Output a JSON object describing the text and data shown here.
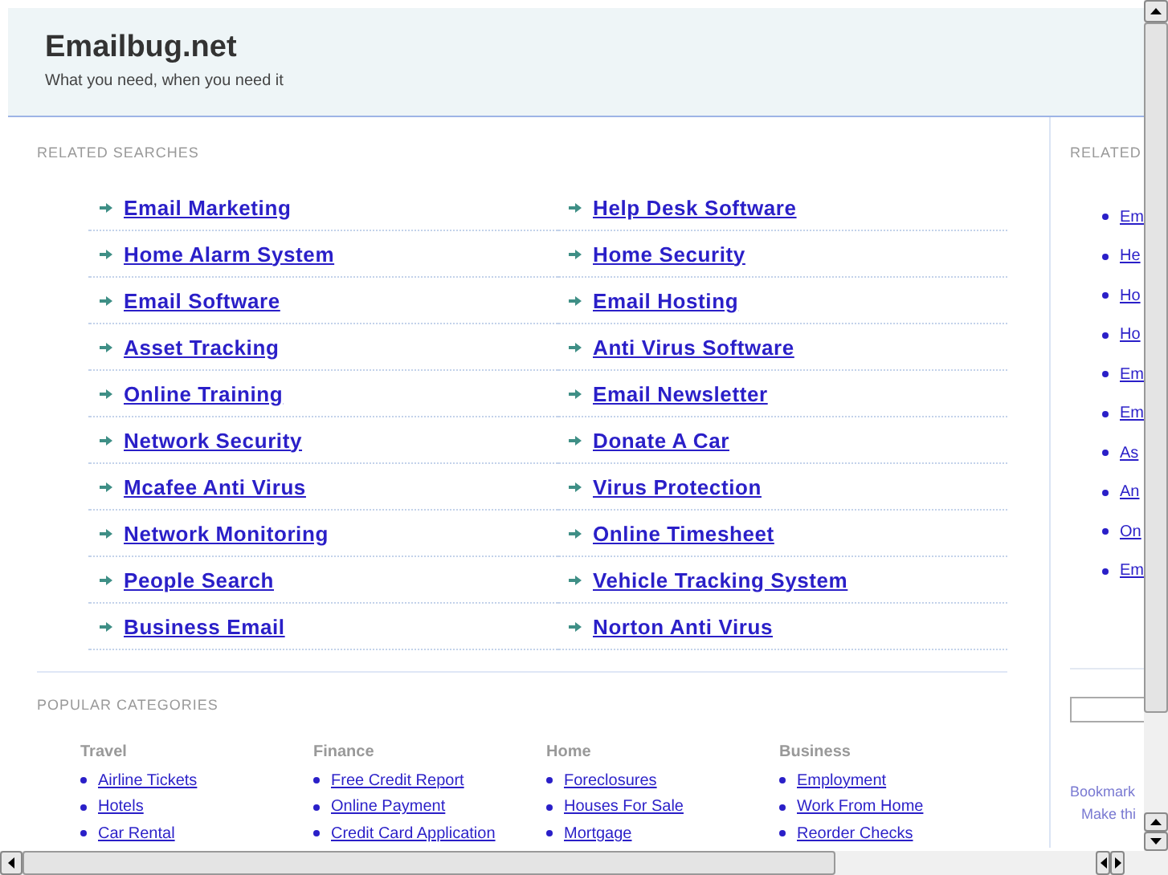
{
  "header": {
    "title": "Emailbug.net",
    "tagline": "What you need, when you need it"
  },
  "related_searches": {
    "heading": "RELATED SEARCHES",
    "links": [
      "Email Marketing",
      "Home Alarm System",
      "Email Software",
      "Asset Tracking",
      "Online Training",
      "Network Security",
      "Mcafee Anti Virus",
      "Network Monitoring",
      "People Search",
      "Business Email",
      "Help Desk Software",
      "Home Security",
      "Email Hosting",
      "Anti Virus Software",
      "Email Newsletter",
      "Donate A Car",
      "Virus Protection",
      "Online Timesheet",
      "Vehicle Tracking System",
      "Norton Anti Virus"
    ]
  },
  "popular_categories": {
    "heading": "POPULAR CATEGORIES",
    "categories": [
      {
        "name": "Travel",
        "links": [
          "Airline Tickets",
          "Hotels",
          "Car Rental"
        ]
      },
      {
        "name": "Finance",
        "links": [
          "Free Credit Report",
          "Online Payment",
          "Credit Card Application"
        ]
      },
      {
        "name": "Home",
        "links": [
          "Foreclosures",
          "Houses For Sale",
          "Mortgage"
        ]
      },
      {
        "name": "Business",
        "links": [
          "Employment",
          "Work From Home",
          "Reorder Checks"
        ]
      }
    ]
  },
  "sidebar": {
    "heading": "RELATED",
    "links": [
      "Em",
      "He",
      "Ho",
      "Ho",
      "Em",
      "Em",
      "As",
      "An",
      "On",
      "Em"
    ],
    "footer_links": [
      "Bookmark",
      "Make thi"
    ]
  }
}
